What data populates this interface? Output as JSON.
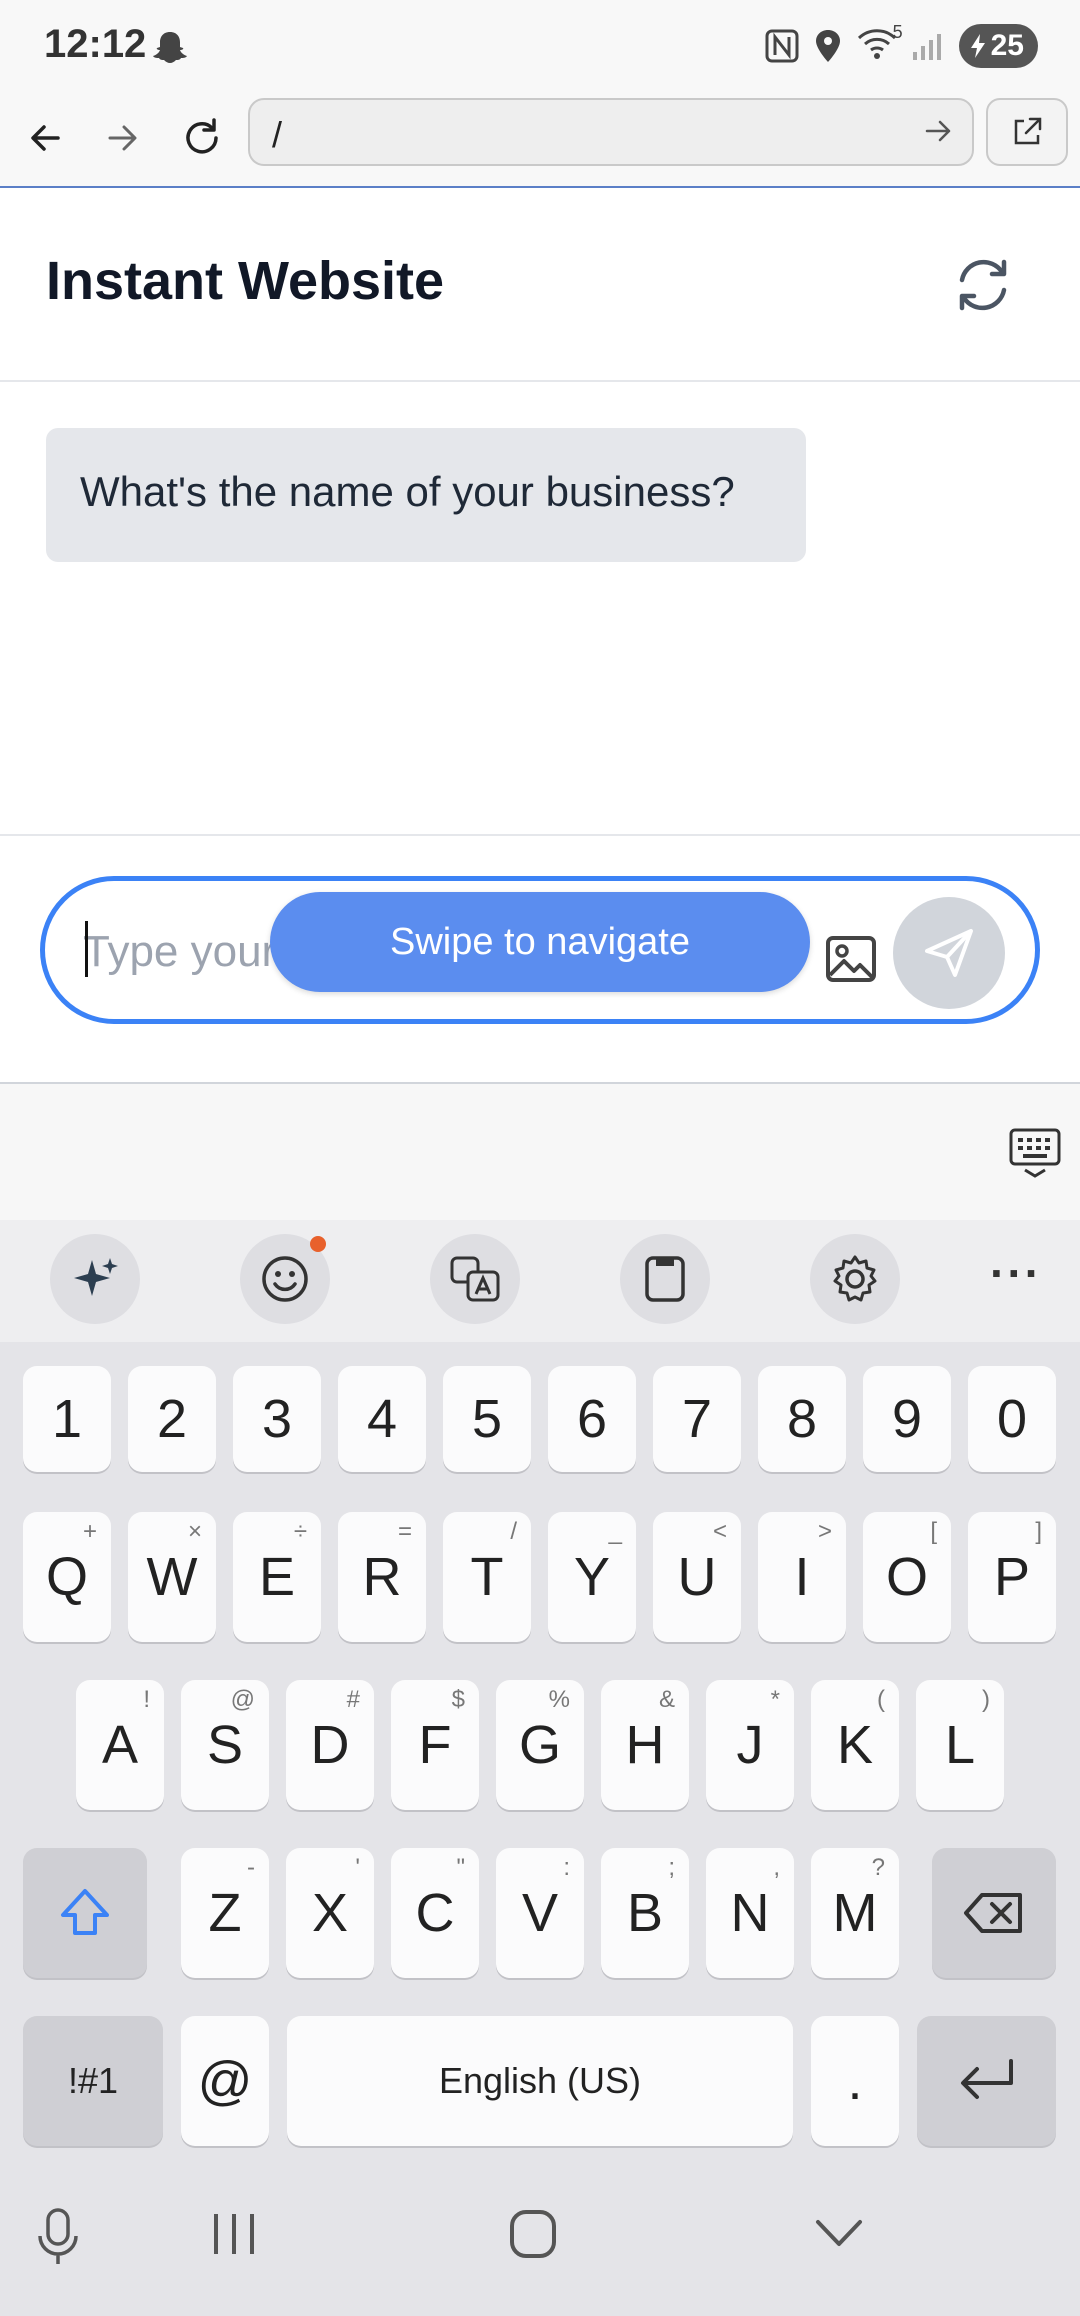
{
  "status_bar": {
    "time": "12:12",
    "left_icon": "snapchat-ghost-icon",
    "icons": [
      "nfc-icon",
      "location-icon",
      "wifi-icon",
      "signal-icon"
    ],
    "wifi_label": "5",
    "battery": "25"
  },
  "browser": {
    "url": "/",
    "buttons": [
      "back-icon",
      "forward-icon",
      "reload-icon",
      "go-icon",
      "open-external-icon"
    ]
  },
  "app": {
    "title": "Instant Website"
  },
  "chat": {
    "messages": [
      {
        "from": "bot",
        "text": "What's the name of your business?"
      }
    ]
  },
  "composer": {
    "placeholder": "Type your message...",
    "toast": "Swipe to navigate"
  },
  "keyboard": {
    "toolbar": [
      "ai-sparkle-icon",
      "emoji-icon",
      "translate-icon",
      "clipboard-icon",
      "settings-icon",
      "more-icon"
    ],
    "more_label": "···",
    "row_numbers": [
      "1",
      "2",
      "3",
      "4",
      "5",
      "6",
      "7",
      "8",
      "9",
      "0"
    ],
    "row_q": [
      {
        "k": "Q",
        "s": "+"
      },
      {
        "k": "W",
        "s": "×"
      },
      {
        "k": "E",
        "s": "÷"
      },
      {
        "k": "R",
        "s": "="
      },
      {
        "k": "T",
        "s": "/"
      },
      {
        "k": "Y",
        "s": "_"
      },
      {
        "k": "U",
        "s": "<"
      },
      {
        "k": "I",
        "s": ">"
      },
      {
        "k": "O",
        "s": "["
      },
      {
        "k": "P",
        "s": "]"
      }
    ],
    "row_a": [
      {
        "k": "A",
        "s": "!"
      },
      {
        "k": "S",
        "s": "@"
      },
      {
        "k": "D",
        "s": "#"
      },
      {
        "k": "F",
        "s": "$"
      },
      {
        "k": "G",
        "s": "%"
      },
      {
        "k": "H",
        "s": "&"
      },
      {
        "k": "J",
        "s": "*"
      },
      {
        "k": "K",
        "s": "("
      },
      {
        "k": "L",
        "s": ")"
      }
    ],
    "row_z": [
      {
        "k": "Z",
        "s": "-"
      },
      {
        "k": "X",
        "s": "'"
      },
      {
        "k": "C",
        "s": "\""
      },
      {
        "k": "V",
        "s": ":"
      },
      {
        "k": "B",
        "s": ";"
      },
      {
        "k": "N",
        "s": ","
      },
      {
        "k": "M",
        "s": "?"
      }
    ],
    "symbols_label": "!#1",
    "at_label": "@",
    "space_label": "English (US)",
    "period_label": "."
  },
  "nav": [
    "microphone-icon",
    "recent-apps-icon",
    "home-icon",
    "hide-keyboard-icon"
  ]
}
